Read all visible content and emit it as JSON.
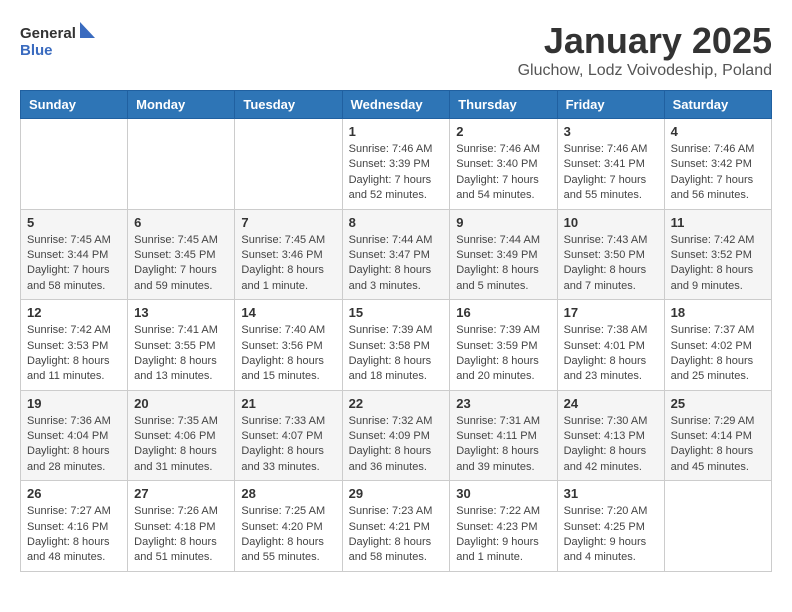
{
  "header": {
    "logo_general": "General",
    "logo_blue": "Blue",
    "month_year": "January 2025",
    "location": "Gluchow, Lodz Voivodeship, Poland"
  },
  "days_of_week": [
    "Sunday",
    "Monday",
    "Tuesday",
    "Wednesday",
    "Thursday",
    "Friday",
    "Saturday"
  ],
  "weeks": [
    [
      {
        "day": "",
        "info": ""
      },
      {
        "day": "",
        "info": ""
      },
      {
        "day": "",
        "info": ""
      },
      {
        "day": "1",
        "info": "Sunrise: 7:46 AM\nSunset: 3:39 PM\nDaylight: 7 hours and 52 minutes."
      },
      {
        "day": "2",
        "info": "Sunrise: 7:46 AM\nSunset: 3:40 PM\nDaylight: 7 hours and 54 minutes."
      },
      {
        "day": "3",
        "info": "Sunrise: 7:46 AM\nSunset: 3:41 PM\nDaylight: 7 hours and 55 minutes."
      },
      {
        "day": "4",
        "info": "Sunrise: 7:46 AM\nSunset: 3:42 PM\nDaylight: 7 hours and 56 minutes."
      }
    ],
    [
      {
        "day": "5",
        "info": "Sunrise: 7:45 AM\nSunset: 3:44 PM\nDaylight: 7 hours and 58 minutes."
      },
      {
        "day": "6",
        "info": "Sunrise: 7:45 AM\nSunset: 3:45 PM\nDaylight: 7 hours and 59 minutes."
      },
      {
        "day": "7",
        "info": "Sunrise: 7:45 AM\nSunset: 3:46 PM\nDaylight: 8 hours and 1 minute."
      },
      {
        "day": "8",
        "info": "Sunrise: 7:44 AM\nSunset: 3:47 PM\nDaylight: 8 hours and 3 minutes."
      },
      {
        "day": "9",
        "info": "Sunrise: 7:44 AM\nSunset: 3:49 PM\nDaylight: 8 hours and 5 minutes."
      },
      {
        "day": "10",
        "info": "Sunrise: 7:43 AM\nSunset: 3:50 PM\nDaylight: 8 hours and 7 minutes."
      },
      {
        "day": "11",
        "info": "Sunrise: 7:42 AM\nSunset: 3:52 PM\nDaylight: 8 hours and 9 minutes."
      }
    ],
    [
      {
        "day": "12",
        "info": "Sunrise: 7:42 AM\nSunset: 3:53 PM\nDaylight: 8 hours and 11 minutes."
      },
      {
        "day": "13",
        "info": "Sunrise: 7:41 AM\nSunset: 3:55 PM\nDaylight: 8 hours and 13 minutes."
      },
      {
        "day": "14",
        "info": "Sunrise: 7:40 AM\nSunset: 3:56 PM\nDaylight: 8 hours and 15 minutes."
      },
      {
        "day": "15",
        "info": "Sunrise: 7:39 AM\nSunset: 3:58 PM\nDaylight: 8 hours and 18 minutes."
      },
      {
        "day": "16",
        "info": "Sunrise: 7:39 AM\nSunset: 3:59 PM\nDaylight: 8 hours and 20 minutes."
      },
      {
        "day": "17",
        "info": "Sunrise: 7:38 AM\nSunset: 4:01 PM\nDaylight: 8 hours and 23 minutes."
      },
      {
        "day": "18",
        "info": "Sunrise: 7:37 AM\nSunset: 4:02 PM\nDaylight: 8 hours and 25 minutes."
      }
    ],
    [
      {
        "day": "19",
        "info": "Sunrise: 7:36 AM\nSunset: 4:04 PM\nDaylight: 8 hours and 28 minutes."
      },
      {
        "day": "20",
        "info": "Sunrise: 7:35 AM\nSunset: 4:06 PM\nDaylight: 8 hours and 31 minutes."
      },
      {
        "day": "21",
        "info": "Sunrise: 7:33 AM\nSunset: 4:07 PM\nDaylight: 8 hours and 33 minutes."
      },
      {
        "day": "22",
        "info": "Sunrise: 7:32 AM\nSunset: 4:09 PM\nDaylight: 8 hours and 36 minutes."
      },
      {
        "day": "23",
        "info": "Sunrise: 7:31 AM\nSunset: 4:11 PM\nDaylight: 8 hours and 39 minutes."
      },
      {
        "day": "24",
        "info": "Sunrise: 7:30 AM\nSunset: 4:13 PM\nDaylight: 8 hours and 42 minutes."
      },
      {
        "day": "25",
        "info": "Sunrise: 7:29 AM\nSunset: 4:14 PM\nDaylight: 8 hours and 45 minutes."
      }
    ],
    [
      {
        "day": "26",
        "info": "Sunrise: 7:27 AM\nSunset: 4:16 PM\nDaylight: 8 hours and 48 minutes."
      },
      {
        "day": "27",
        "info": "Sunrise: 7:26 AM\nSunset: 4:18 PM\nDaylight: 8 hours and 51 minutes."
      },
      {
        "day": "28",
        "info": "Sunrise: 7:25 AM\nSunset: 4:20 PM\nDaylight: 8 hours and 55 minutes."
      },
      {
        "day": "29",
        "info": "Sunrise: 7:23 AM\nSunset: 4:21 PM\nDaylight: 8 hours and 58 minutes."
      },
      {
        "day": "30",
        "info": "Sunrise: 7:22 AM\nSunset: 4:23 PM\nDaylight: 9 hours and 1 minute."
      },
      {
        "day": "31",
        "info": "Sunrise: 7:20 AM\nSunset: 4:25 PM\nDaylight: 9 hours and 4 minutes."
      },
      {
        "day": "",
        "info": ""
      }
    ]
  ]
}
